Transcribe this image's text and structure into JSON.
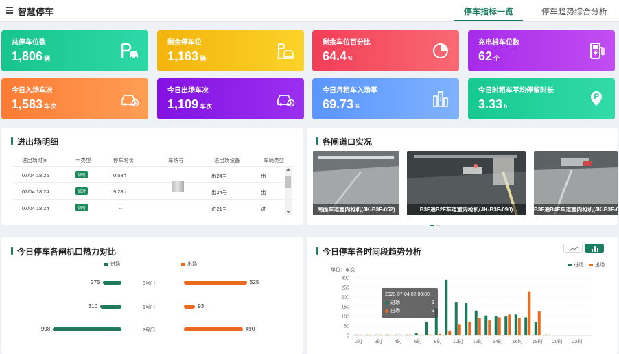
{
  "header": {
    "title": "智慧停车",
    "tabs": [
      {
        "label": "停车指标一览",
        "active": true
      },
      {
        "label": "停车趋势综合分析",
        "active": false
      }
    ]
  },
  "cards": [
    {
      "label": "总停车位数",
      "value": "1,806",
      "unit": "辆",
      "icon": "parking-p-icon",
      "color": "#1ed09a"
    },
    {
      "label": "剩余停车位",
      "value": "1,163",
      "unit": "辆",
      "icon": "parking-slot-icon",
      "color": "#f7c210"
    },
    {
      "label": "剩余车位百分比",
      "value": "64.4",
      "unit": "%",
      "icon": "pie-chart-icon",
      "color": "#f44d6a"
    },
    {
      "label": "充电桩车位数",
      "value": "62",
      "unit": "个",
      "icon": "charging-pile-icon",
      "color": "#b33ff0"
    },
    {
      "label": "今日入场车次",
      "value": "1,583",
      "unit": "车次",
      "icon": "car-entry-icon",
      "color": "#ff8a3d"
    },
    {
      "label": "今日出场车次",
      "value": "1,109",
      "unit": "车次",
      "icon": "car-exit-icon",
      "color": "#8c18e6"
    },
    {
      "label": "今日月租车入场率",
      "value": "69.73",
      "unit": "%",
      "icon": "bar-building-icon",
      "color": "#6aa3ff"
    },
    {
      "label": "今日时租车平均停留时长",
      "value": "3.33",
      "unit": "h",
      "icon": "location-pin-icon",
      "color": "#1fd49b"
    }
  ],
  "records": {
    "title": "进出场明细",
    "columns": [
      "进出场时间",
      "卡类型",
      "停车时长",
      "车牌号",
      "进出场设备",
      "车辆类型"
    ],
    "rows": [
      {
        "time": "07/04 18:25",
        "card": "临时",
        "duration": "0.58h",
        "plate": "",
        "device": "出24号",
        "type": "出"
      },
      {
        "time": "07/04 18:24",
        "card": "临时",
        "duration": "9.28h",
        "plate": "",
        "device": "出24号",
        "type": "出"
      },
      {
        "time": "07/04 18:24",
        "card": "临时",
        "duration": "--",
        "plate": "",
        "device": "进21号",
        "type": "进"
      }
    ]
  },
  "cameras": {
    "title": "各闸道口实况",
    "items": [
      {
        "label": "南面车道室内枪机(JK-B3F-052)"
      },
      {
        "label": "B3F通B2F车道室内枪机(JK-B3F-090)"
      },
      {
        "label": "B3F通B4F车道室内枪机(JK-B3F-0"
      }
    ]
  },
  "heat": {
    "title": "今日停车各闸机口热力对比",
    "legend_in": "进场",
    "legend_out": "出场",
    "color_in": "#1f7a5a",
    "color_out": "#ea6a1f",
    "gates": [
      {
        "name": "5号门",
        "in": 275,
        "out": 525
      },
      {
        "name": "1号门",
        "in": 310,
        "out": 93
      },
      {
        "name": "2号门",
        "in": 998,
        "out": 490
      }
    ]
  },
  "trend": {
    "title": "今日停车各时间段趋势分析",
    "toggle": [
      "line-chart-icon",
      "bar-chart-icon"
    ],
    "tooltip": {
      "time": "2023-07-04 02:00:00",
      "in_label": "进场",
      "in_value": "3",
      "out_label": "出场",
      "out_value": "3"
    }
  },
  "chart_data": {
    "type": "bar",
    "unit_label": "单位：车次",
    "ylim": [
      0,
      300
    ],
    "yticks": [
      0,
      50,
      100,
      150,
      200,
      250,
      300
    ],
    "xticks": [
      "0时",
      "2时",
      "4时",
      "6时",
      "8时",
      "10时",
      "12时",
      "14时",
      "16时",
      "18时",
      "20时",
      "22时"
    ],
    "x": [
      0,
      1,
      2,
      3,
      4,
      5,
      6,
      7,
      8,
      9,
      10,
      11,
      12,
      13,
      14,
      15,
      16,
      17,
      18,
      19,
      20,
      21,
      22,
      23
    ],
    "series": [
      {
        "name": "进场",
        "color": "#1f7a5a",
        "values": [
          2,
          1,
          3,
          1,
          1,
          2,
          12,
          70,
          140,
          290,
          175,
          170,
          130,
          105,
          100,
          100,
          110,
          95,
          70,
          2,
          0,
          0,
          0,
          0
        ]
      },
      {
        "name": "出场",
        "color": "#ea6a1f",
        "values": [
          1,
          2,
          3,
          1,
          1,
          1,
          3,
          5,
          8,
          25,
          60,
          70,
          90,
          80,
          95,
          110,
          90,
          230,
          125,
          2,
          0,
          0,
          0,
          0
        ]
      }
    ],
    "legend": "top-right",
    "grid": true
  }
}
